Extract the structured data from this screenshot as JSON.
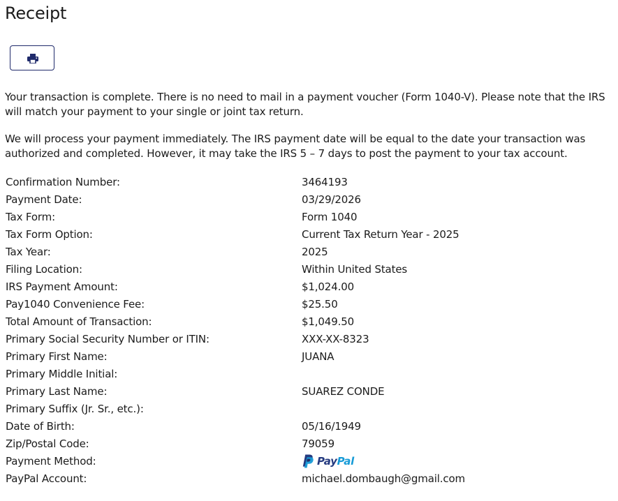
{
  "page": {
    "title": "Receipt"
  },
  "toolbar": {
    "print_icon": "printer-icon"
  },
  "messages": {
    "paragraph1": "Your transaction is complete. There is no need to mail in a payment voucher (Form 1040-V). Please note that the IRS will match your payment to your single or joint tax return.",
    "paragraph2": "We will process your payment immediately. The IRS payment date will be equal to the date your transaction was authorized and completed. However, it may take the IRS 5 – 7 days to post the payment to your tax account."
  },
  "details": [
    {
      "label": "Confirmation Number:",
      "value": "3464193"
    },
    {
      "label": "Payment Date:",
      "value": "03/29/2026"
    },
    {
      "label": "Tax Form:",
      "value": "Form 1040"
    },
    {
      "label": "Tax Form Option:",
      "value": "Current Tax Return Year - 2025"
    },
    {
      "label": "Tax Year:",
      "value": "2025"
    },
    {
      "label": "Filing Location:",
      "value": "Within United States"
    },
    {
      "label": "IRS Payment Amount:",
      "value": "$1,024.00"
    },
    {
      "label": "Pay1040 Convenience Fee:",
      "value": "$25.50"
    },
    {
      "label": "Total Amount of Transaction:",
      "value": "$1,049.50"
    },
    {
      "label": "Primary Social Security Number or ITIN:",
      "value": "XXX-XX-8323"
    },
    {
      "label": "Primary First Name:",
      "value": "JUANA"
    },
    {
      "label": "Primary Middle Initial:",
      "value": ""
    },
    {
      "label": "Primary Last Name:",
      "value": "SUAREZ CONDE"
    },
    {
      "label": "Primary Suffix (Jr. Sr., etc.):",
      "value": ""
    },
    {
      "label": "Date of Birth:",
      "value": "05/16/1949"
    },
    {
      "label": "Zip/Postal Code:",
      "value": "79059"
    },
    {
      "label": "Payment Method:",
      "value": ""
    },
    {
      "label": "PayPal Account:",
      "value": "michael.dombaugh@gmail.com"
    }
  ],
  "payment_method_logo": {
    "icon": "paypal-logo-icon",
    "word_part1": "Pay",
    "word_part2": "Pal",
    "color_dark": "#253b80",
    "color_light": "#179bd7"
  },
  "colors": {
    "button_border": "#1f2a6b",
    "text": "#1b1b1b"
  }
}
